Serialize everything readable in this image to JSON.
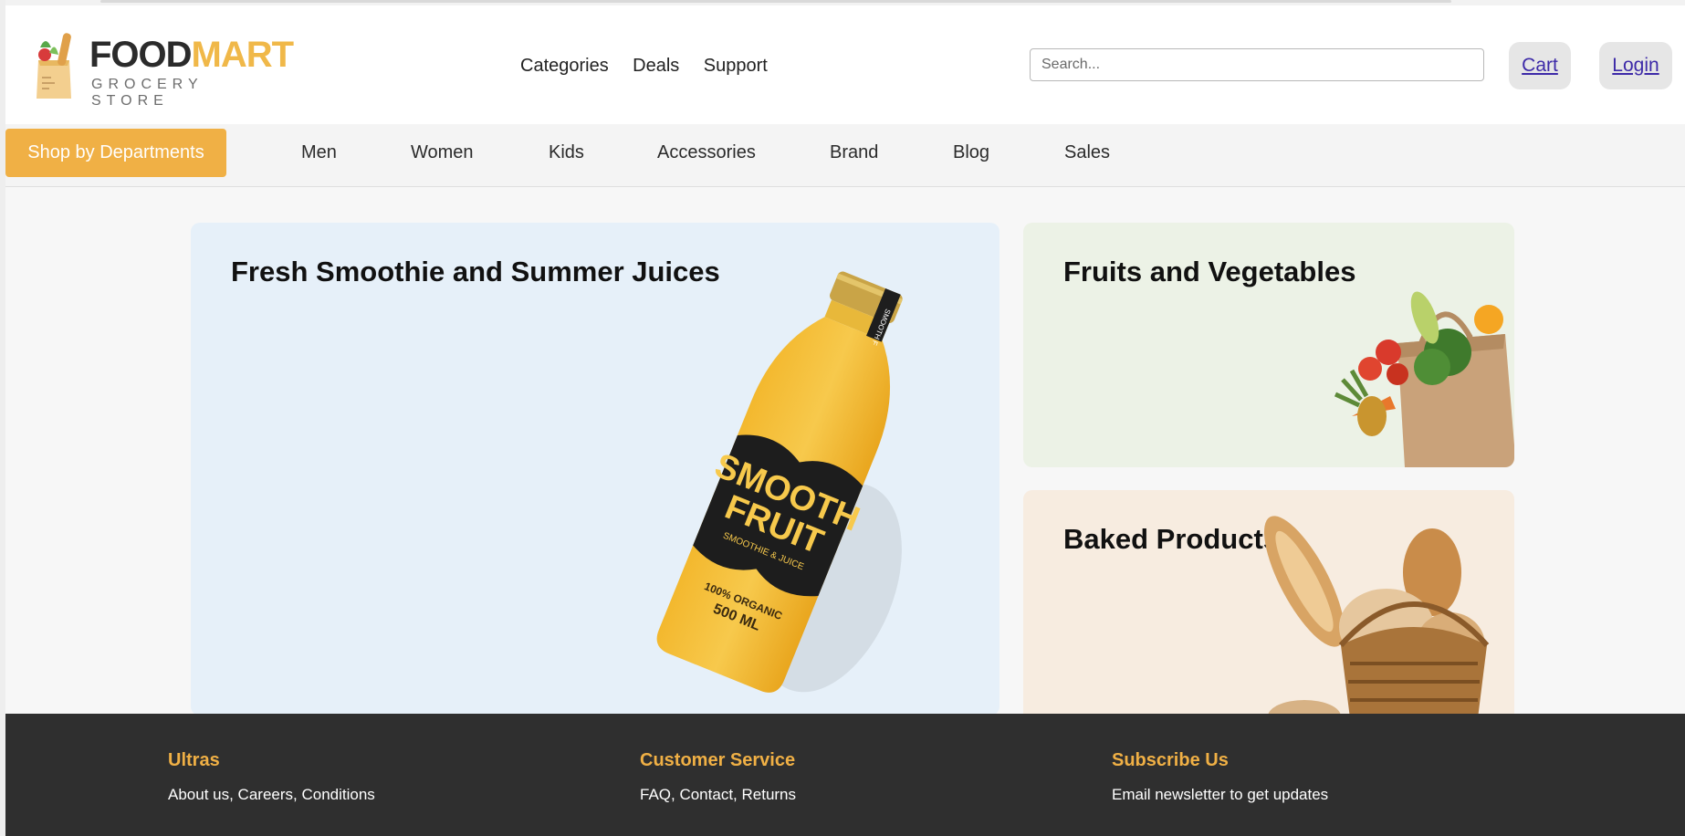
{
  "brand": {
    "name_part1": "FOOD",
    "name_part2": "MART",
    "tagline": "GROCERY STORE"
  },
  "nav": {
    "items": [
      "Categories",
      "Deals",
      "Support"
    ]
  },
  "search": {
    "placeholder": "Search..."
  },
  "header_actions": {
    "cart": "Cart",
    "login": "Login"
  },
  "subnav": {
    "departments_button": "Shop by Departments",
    "links": [
      "Men",
      "Women",
      "Kids",
      "Accessories",
      "Brand",
      "Blog",
      "Sales"
    ]
  },
  "cards": [
    {
      "title": "Fresh Smoothie and Summer Juices",
      "image": "smoothie-bottle"
    },
    {
      "title": "Fruits and Vegetables",
      "image": "grocery-bag"
    },
    {
      "title": "Baked Products",
      "image": "bread-basket"
    }
  ],
  "bottle_label": {
    "line1": "SMOOTH",
    "line2": "FRUIT",
    "line3": "SMOOTHIE & JUICE",
    "line4": "100% ORGANIC",
    "line5": "500 ML",
    "neck": "SMOOTH F"
  },
  "footer": {
    "columns": [
      {
        "heading": "Ultras",
        "text": "About us, Careers, Conditions"
      },
      {
        "heading": "Customer Service",
        "text": "FAQ, Contact, Returns"
      },
      {
        "heading": "Subscribe Us",
        "text": "Email newsletter to get updates"
      }
    ]
  },
  "colors": {
    "accent": "#f0b045",
    "footer_bg": "#2f2f2f",
    "card_blue": "#e6f0f9",
    "card_green": "#ecf2e6",
    "card_peach": "#f7ece0"
  }
}
